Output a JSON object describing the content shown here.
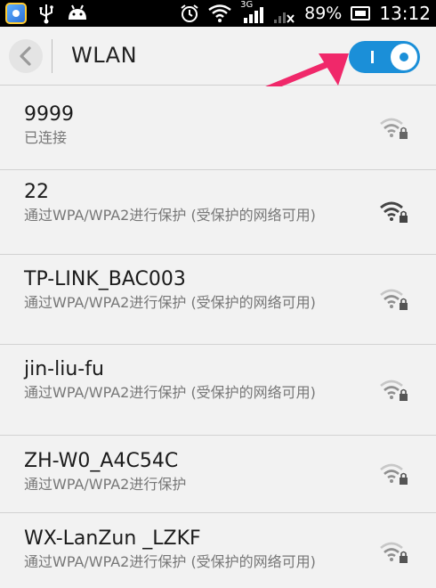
{
  "status_bar": {
    "network_type": "3G",
    "battery": "89%",
    "time": "13:12",
    "icons": [
      "app-icon",
      "usb-icon",
      "android-icon",
      "alarm-icon",
      "wifi-icon",
      "signal-icon",
      "no-signal-icon",
      "battery-icon"
    ]
  },
  "header": {
    "title": "WLAN",
    "back_icon": "chevron-left-icon",
    "wlan_toggle": "on",
    "accent_color": "#1b8fd8",
    "annotation_color": "#f0286a"
  },
  "networks": [
    {
      "ssid": "9999",
      "status": "已连接",
      "signal": "weak"
    },
    {
      "ssid": "22",
      "status": "通过WPA/WPA2进行保护 (受保护的网络可用)",
      "signal": "strong"
    },
    {
      "ssid": "TP-LINK_BAC003",
      "status": "通过WPA/WPA2进行保护 (受保护的网络可用)",
      "signal": "weak"
    },
    {
      "ssid": "jin-liu-fu",
      "status": "通过WPA/WPA2进行保护 (受保护的网络可用)",
      "signal": "weak"
    },
    {
      "ssid": "ZH-W0_A4C54C",
      "status": "通过WPA/WPA2进行保护",
      "signal": "weak"
    },
    {
      "ssid": "WX-LanZun _LZKF",
      "status": "通过WPA/WPA2进行保护 (受保护的网络可用)",
      "signal": "weak"
    }
  ]
}
